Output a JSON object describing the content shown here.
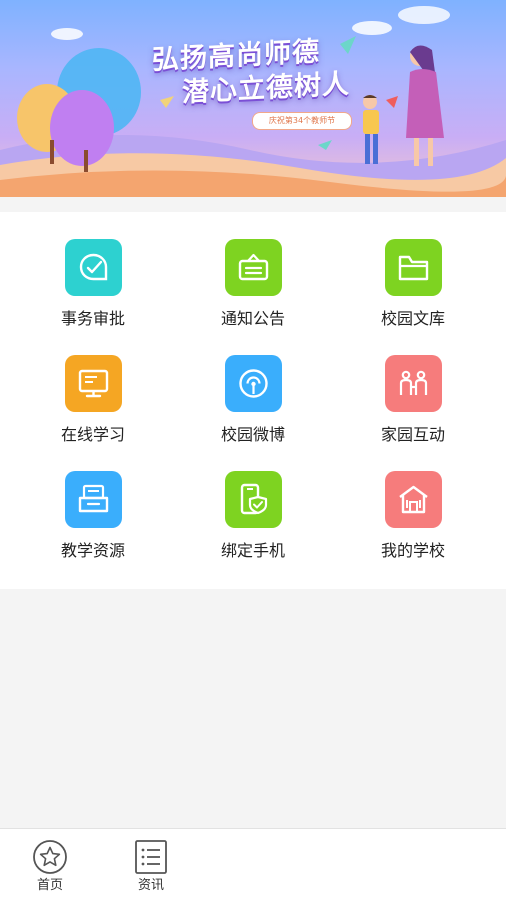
{
  "banner": {
    "title_line1": "弘扬高尚师德",
    "title_line2": "潜心立德树人",
    "subtitle": "庆祝第34个教师节"
  },
  "grid": {
    "items": [
      {
        "label": "事务审批",
        "icon": "approval-chat-check-icon",
        "color": "#2dd1d0"
      },
      {
        "label": "通知公告",
        "icon": "notice-board-icon",
        "color": "#7ed321"
      },
      {
        "label": "校园文库",
        "icon": "folder-icon",
        "color": "#7ed321"
      },
      {
        "label": "在线学习",
        "icon": "monitor-icon",
        "color": "#f5a623"
      },
      {
        "label": "校园微博",
        "icon": "microblog-signal-icon",
        "color": "#3aaefc"
      },
      {
        "label": "家园互动",
        "icon": "family-people-icon",
        "color": "#f67c7c"
      },
      {
        "label": "教学资源",
        "icon": "resources-tray-icon",
        "color": "#3aaefc"
      },
      {
        "label": "绑定手机",
        "icon": "phone-shield-icon",
        "color": "#7ed321"
      },
      {
        "label": "我的学校",
        "icon": "school-building-icon",
        "color": "#f67c7c"
      }
    ]
  },
  "tabbar": {
    "items": [
      {
        "label": "首页",
        "icon": "star-circle-icon"
      },
      {
        "label": "资讯",
        "icon": "news-list-icon"
      }
    ]
  }
}
